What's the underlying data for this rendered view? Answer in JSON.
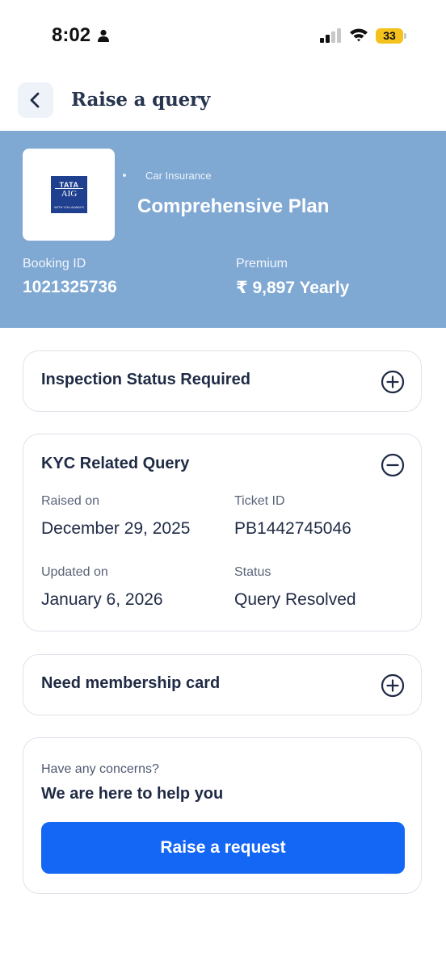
{
  "status_bar": {
    "time": "8:02",
    "battery": "33"
  },
  "header": {
    "title": "Raise a query"
  },
  "policy": {
    "insurer_logo_text": {
      "brand": "TATA",
      "name": "AIG",
      "tagline": "WITH YOU ALWAYS"
    },
    "category": "Car Insurance",
    "plan_name": "Comprehensive Plan",
    "booking_id_label": "Booking ID",
    "booking_id": "1021325736",
    "premium_label": "Premium",
    "premium": "₹ 9,897 Yearly"
  },
  "queries": [
    {
      "title": "Inspection Status Required",
      "expanded": false
    },
    {
      "title": "KYC Related Query",
      "expanded": true,
      "raised_on_label": "Raised on",
      "raised_on": "December 29, 2025",
      "ticket_id_label": "Ticket ID",
      "ticket_id": "PB1442745046",
      "updated_on_label": "Updated on",
      "updated_on": "January 6, 2026",
      "status_label": "Status",
      "status": "Query Resolved"
    },
    {
      "title": "Need membership card",
      "expanded": false
    }
  ],
  "help": {
    "subtitle": "Have any concerns?",
    "title": "We are here to help you",
    "button_label": "Raise a request"
  },
  "colors": {
    "banner": "#7fa8d3",
    "primary_button": "#1466f5",
    "battery": "#f4c21c",
    "text_dark": "#1f2a44"
  },
  "icons": [
    "person-icon",
    "signal-icon",
    "wifi-icon",
    "back-arrow-icon",
    "plus-circle-icon",
    "minus-circle-icon"
  ]
}
